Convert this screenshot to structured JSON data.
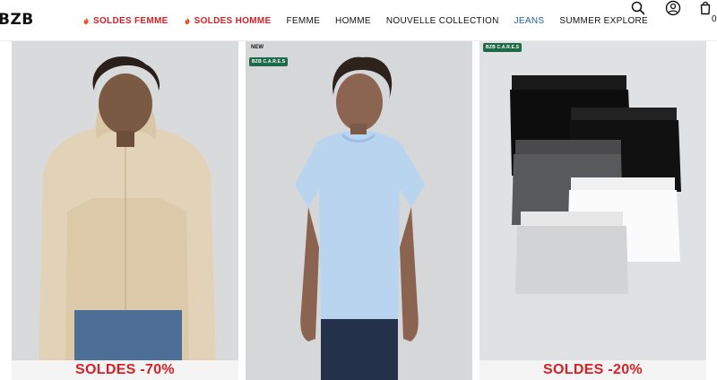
{
  "brand": {
    "logo": "BZB"
  },
  "nav": {
    "items": [
      {
        "label": "SOLDES FEMME",
        "style": "red"
      },
      {
        "label": "SOLDES HOMME",
        "style": "red"
      },
      {
        "label": "FEMME",
        "style": "normal"
      },
      {
        "label": "HOMME",
        "style": "normal"
      },
      {
        "label": "NOUVELLE COLLECTION",
        "style": "normal"
      },
      {
        "label": "JEANS",
        "style": "blue"
      },
      {
        "label": "SUMMER EXPLORE",
        "style": "normal"
      }
    ]
  },
  "header_icons": [
    "search-icon",
    "account-icon",
    "cart-icon"
  ],
  "cart": {
    "count": "0"
  },
  "products": [
    {
      "image": "beige-hooded-jacket",
      "promo": "SOLDES -70%"
    },
    {
      "image": "light-blue-tshirt",
      "new_label": "NEW",
      "badge": "BZB C.A.R.E.S"
    },
    {
      "image": "boxer-briefs-pack",
      "badge": "BZB C.A.R.E.S",
      "promo": "SOLDES -20%"
    }
  ],
  "colors": {
    "sale_red": "#d71f26",
    "jeans_blue": "#1f5fa8",
    "badge_green": "#1f6b49"
  }
}
